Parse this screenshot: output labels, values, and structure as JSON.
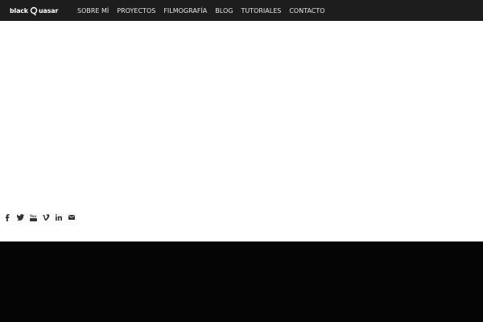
{
  "header": {
    "logo": {
      "text_left": "black",
      "text_right": "uasar",
      "icon": "q-mark-icon"
    },
    "nav": [
      {
        "label": "SOBRE MÍ"
      },
      {
        "label": "PROYECTOS"
      },
      {
        "label": "FILMOGRAFÍA"
      },
      {
        "label": "BLOG"
      },
      {
        "label": "TUTORIALES"
      },
      {
        "label": "CONTACTO"
      }
    ]
  },
  "social": [
    {
      "icon": "facebook-icon"
    },
    {
      "icon": "twitter-icon"
    },
    {
      "icon": "youtube-icon"
    },
    {
      "icon": "vimeo-icon"
    },
    {
      "icon": "linkedin-icon"
    },
    {
      "icon": "mail-icon"
    }
  ],
  "colors": {
    "header_bg": "#1d1d1d",
    "footer_bg": "#050505",
    "icon_color": "#333333"
  }
}
